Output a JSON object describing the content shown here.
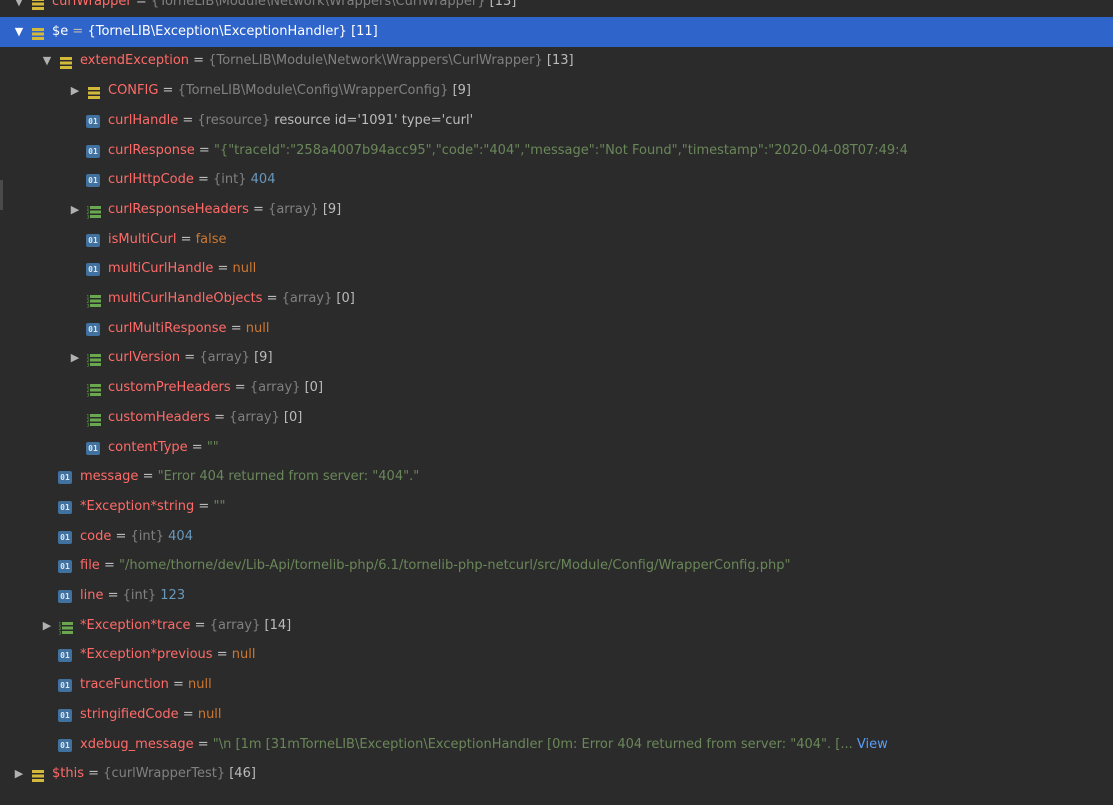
{
  "tree": {
    "rows": [
      {
        "id": "r0",
        "indent": 0,
        "arrow": "▼",
        "icon": "object",
        "name": "curlWrapper",
        "sep": " = ",
        "type": "{TorneLIB\\Module\\Network\\Wrappers\\CurlWrapper}",
        "extra": " [13]",
        "clipped": true
      },
      {
        "id": "r1",
        "indent": 0,
        "arrow": "▼",
        "icon": "object",
        "name": "$e",
        "sep": " = ",
        "type": "{TorneLIB\\Exception\\ExceptionHandler}",
        "extra": " [11]",
        "selected": true
      },
      {
        "id": "r2",
        "indent": 1,
        "arrow": "▼",
        "icon": "object",
        "name": "extendException",
        "sep": " = ",
        "type": "{TorneLIB\\Module\\Network\\Wrappers\\CurlWrapper}",
        "extra": " [13]"
      },
      {
        "id": "r3",
        "indent": 2,
        "arrow": "▶",
        "icon": "object",
        "name": "CONFIG",
        "sep": " = ",
        "type": "{TorneLIB\\Module\\Config\\WrapperConfig}",
        "extra": " [9]"
      },
      {
        "id": "r4",
        "indent": 2,
        "icon": "field",
        "name": "curlHandle",
        "sep": " = ",
        "type": "{resource}",
        "extra": " resource id='1091' type='curl'"
      },
      {
        "id": "r5",
        "indent": 2,
        "icon": "field",
        "name": "curlResponse",
        "sep": " = ",
        "value": "\"{\"traceId\":\"258a4007b94acc95\",\"code\":\"404\",\"message\":\"Not Found\",\"timestamp\":\"2020-04-08T07:49:4",
        "vclass": "v-str"
      },
      {
        "id": "r6",
        "indent": 2,
        "icon": "field",
        "name": "curlHttpCode",
        "sep": " = ",
        "type": "{int}",
        "value": " 404",
        "vclass": "v-num"
      },
      {
        "id": "r7",
        "indent": 2,
        "arrow": "▶",
        "icon": "array",
        "name": "curlResponseHeaders",
        "sep": " = ",
        "type": "{array}",
        "extra": " [9]"
      },
      {
        "id": "r8",
        "indent": 2,
        "icon": "field",
        "name": "isMultiCurl",
        "sep": " = ",
        "value": "false",
        "vclass": "v-kw"
      },
      {
        "id": "r9",
        "indent": 2,
        "icon": "field",
        "name": "multiCurlHandle",
        "sep": " = ",
        "value": "null",
        "vclass": "v-kw"
      },
      {
        "id": "r10",
        "indent": 2,
        "icon": "array",
        "name": "multiCurlHandleObjects",
        "sep": " = ",
        "type": "{array}",
        "extra": " [0]"
      },
      {
        "id": "r11",
        "indent": 2,
        "icon": "field",
        "name": "curlMultiResponse",
        "sep": " = ",
        "value": "null",
        "vclass": "v-kw"
      },
      {
        "id": "r12",
        "indent": 2,
        "arrow": "▶",
        "icon": "array",
        "name": "curlVersion",
        "sep": " = ",
        "type": "{array}",
        "extra": " [9]"
      },
      {
        "id": "r13",
        "indent": 2,
        "icon": "array",
        "name": "customPreHeaders",
        "sep": " = ",
        "type": "{array}",
        "extra": " [0]"
      },
      {
        "id": "r14",
        "indent": 2,
        "icon": "array",
        "name": "customHeaders",
        "sep": " = ",
        "type": "{array}",
        "extra": " [0]"
      },
      {
        "id": "r15",
        "indent": 2,
        "icon": "field",
        "name": "contentType",
        "sep": " = ",
        "value": "\"\"",
        "vclass": "v-str"
      },
      {
        "id": "r16",
        "indent": 1,
        "icon": "field",
        "name": "message",
        "sep": " = ",
        "value": "\"Error 404 returned from server: \"404\".\"",
        "vclass": "v-str"
      },
      {
        "id": "r17",
        "indent": 1,
        "icon": "field",
        "name": "*Exception*string",
        "sep": " = ",
        "value": "\"\"",
        "vclass": "v-str"
      },
      {
        "id": "r18",
        "indent": 1,
        "icon": "field",
        "name": "code",
        "sep": " = ",
        "type": "{int}",
        "value": " 404",
        "vclass": "v-num"
      },
      {
        "id": "r19",
        "indent": 1,
        "icon": "field",
        "name": "file",
        "sep": " = ",
        "value": "\"/home/thorne/dev/Lib-Api/tornelib-php/6.1/tornelib-php-netcurl/src/Module/Config/WrapperConfig.php\"",
        "vclass": "v-str"
      },
      {
        "id": "r20",
        "indent": 1,
        "icon": "field",
        "name": "line",
        "sep": " = ",
        "type": "{int}",
        "value": " 123",
        "vclass": "v-num"
      },
      {
        "id": "r21",
        "indent": 1,
        "arrow": "▶",
        "icon": "array",
        "name": "*Exception*trace",
        "sep": " = ",
        "type": "{array}",
        "extra": " [14]"
      },
      {
        "id": "r22",
        "indent": 1,
        "icon": "field",
        "name": "*Exception*previous",
        "sep": " = ",
        "value": "null",
        "vclass": "v-kw"
      },
      {
        "id": "r23",
        "indent": 1,
        "icon": "field",
        "name": "traceFunction",
        "sep": " = ",
        "value": "null",
        "vclass": "v-kw"
      },
      {
        "id": "r24",
        "indent": 1,
        "icon": "field",
        "name": "stringifiedCode",
        "sep": " = ",
        "value": "null",
        "vclass": "v-kw"
      },
      {
        "id": "r25",
        "indent": 1,
        "icon": "field",
        "name": "xdebug_message",
        "sep": " = ",
        "value": "\"\\n [1m [31mTorneLIB\\Exception\\ExceptionHandler [0m: Error 404 returned from server: \"404\". [...",
        "vclass": "v-str",
        "link": " View"
      },
      {
        "id": "r26",
        "indent": 0,
        "arrow": "▶",
        "icon": "object",
        "name": "$this",
        "sep": " = ",
        "type": "{curlWrapperTest}",
        "extra": " [46]"
      }
    ],
    "icon_labels": {
      "field": "01"
    },
    "colors": {
      "background": "#2b2b2b",
      "selection": "#2f65ca",
      "name": "#ff6b68",
      "string": "#6a8759",
      "number": "#6897bb",
      "keyword": "#cc7832",
      "type": "#808080",
      "object_icon": "#d4b83a",
      "array_icon": "#6aa84f"
    }
  }
}
